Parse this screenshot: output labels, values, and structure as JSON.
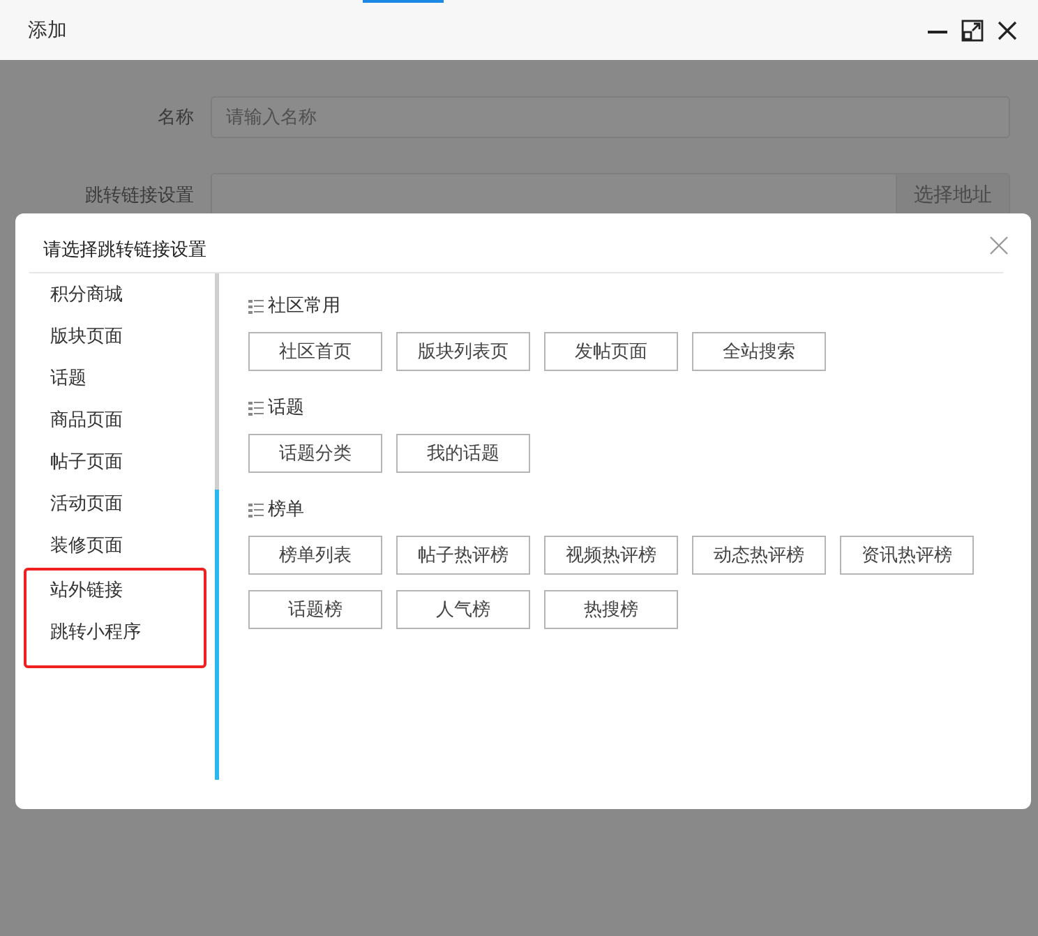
{
  "window": {
    "title": "添加"
  },
  "form": [
    {
      "label": "名称",
      "placeholder": "请输入名称"
    },
    {
      "label": "跳转链接设置",
      "button": "选择地址"
    }
  ],
  "dialog": {
    "title": "请选择跳转链接设置",
    "sidebar": [
      {
        "label": "积分商城",
        "highlighted": false
      },
      {
        "label": "版块页面",
        "highlighted": false
      },
      {
        "label": "话题",
        "highlighted": false
      },
      {
        "label": "商品页面",
        "highlighted": false
      },
      {
        "label": "帖子页面",
        "highlighted": false
      },
      {
        "label": "活动页面",
        "highlighted": false
      },
      {
        "label": "装修页面",
        "highlighted": false
      },
      {
        "label": "站外链接",
        "highlighted": true
      },
      {
        "label": "跳转小程序",
        "highlighted": true
      }
    ],
    "sections": [
      {
        "title": "社区常用",
        "links": [
          "社区首页",
          "版块列表页",
          "发帖页面",
          "全站搜索"
        ]
      },
      {
        "title": "话题",
        "links": [
          "话题分类",
          "我的话题"
        ]
      },
      {
        "title": "榜单",
        "links": [
          "榜单列表",
          "帖子热评榜",
          "视频热评榜",
          "动态热评榜",
          "资讯热评榜",
          "话题榜",
          "人气榜",
          "热搜榜"
        ]
      }
    ]
  }
}
